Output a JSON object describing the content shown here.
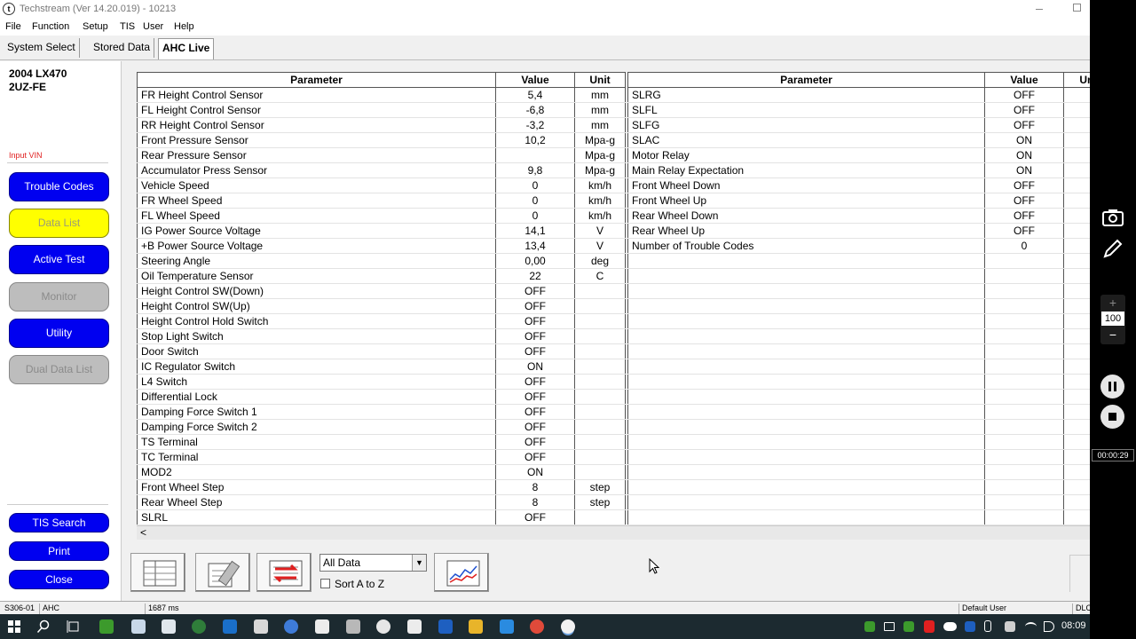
{
  "window": {
    "title": "Techstream (Ver 14.20.019) - 10213",
    "app_icon_glyph": "t"
  },
  "menu": [
    "File",
    "Function",
    "Setup",
    "TIS",
    "User",
    "Help"
  ],
  "tabs": [
    {
      "label": "System Select",
      "active": false
    },
    {
      "label": "Stored Data",
      "active": false
    },
    {
      "label": "AHC Live",
      "active": true
    }
  ],
  "vehicle": {
    "model": "2004 LX470",
    "engine": "2UZ-FE",
    "input_vin": "Input VIN"
  },
  "sidebar_buttons": [
    {
      "label": "Trouble Codes",
      "state": "blue"
    },
    {
      "label": "Data List",
      "state": "yellow"
    },
    {
      "label": "Active Test",
      "state": "blue"
    },
    {
      "label": "Monitor",
      "state": "gray"
    },
    {
      "label": "Utility",
      "state": "blue"
    },
    {
      "label": "Dual Data List",
      "state": "gray"
    }
  ],
  "sidebar_bottom_buttons": [
    {
      "label": "TIS Search"
    },
    {
      "label": "Print"
    },
    {
      "label": "Close"
    }
  ],
  "left_table": {
    "headers": [
      "Parameter",
      "Value",
      "Unit"
    ],
    "rows": [
      [
        "FR Height Control Sensor",
        "5,4",
        "mm"
      ],
      [
        "FL Height Control Sensor",
        "-6,8",
        "mm"
      ],
      [
        "RR Height Control Sensor",
        "-3,2",
        "mm"
      ],
      [
        "Front Pressure Sensor",
        "10,2",
        "Mpa-g"
      ],
      [
        "Rear Pressure Sensor",
        "",
        "Mpa-g"
      ],
      [
        "Accumulator Press Sensor",
        "9,8",
        "Mpa-g"
      ],
      [
        "Vehicle Speed",
        "0",
        "km/h"
      ],
      [
        "FR Wheel Speed",
        "0",
        "km/h"
      ],
      [
        "FL Wheel Speed",
        "0",
        "km/h"
      ],
      [
        "IG Power Source Voltage",
        "14,1",
        "V"
      ],
      [
        "+B Power Source Voltage",
        "13,4",
        "V"
      ],
      [
        "Steering Angle",
        "0,00",
        "deg"
      ],
      [
        "Oil Temperature Sensor",
        "22",
        "C"
      ],
      [
        "Height Control SW(Down)",
        "OFF",
        ""
      ],
      [
        "Height Control SW(Up)",
        "OFF",
        ""
      ],
      [
        "Height Control Hold Switch",
        "OFF",
        ""
      ],
      [
        "Stop Light Switch",
        "OFF",
        ""
      ],
      [
        "Door Switch",
        "OFF",
        ""
      ],
      [
        "IC Regulator Switch",
        "ON",
        ""
      ],
      [
        "L4 Switch",
        "OFF",
        ""
      ],
      [
        "Differential Lock",
        "OFF",
        ""
      ],
      [
        "Damping Force Switch 1",
        "OFF",
        ""
      ],
      [
        "Damping Force Switch 2",
        "OFF",
        ""
      ],
      [
        "TS Terminal",
        "OFF",
        ""
      ],
      [
        "TC Terminal",
        "OFF",
        ""
      ],
      [
        "MOD2",
        "ON",
        ""
      ],
      [
        "Front Wheel Step",
        "8",
        "step"
      ],
      [
        "Rear Wheel Step",
        "8",
        "step"
      ],
      [
        "SLRL",
        "OFF",
        ""
      ]
    ]
  },
  "right_table": {
    "headers": [
      "Parameter",
      "Value",
      "Ur"
    ],
    "rows": [
      [
        "SLRG",
        "OFF",
        ""
      ],
      [
        "SLFL",
        "OFF",
        ""
      ],
      [
        "SLFG",
        "OFF",
        ""
      ],
      [
        "SLAC",
        "ON",
        ""
      ],
      [
        "Motor Relay",
        "ON",
        ""
      ],
      [
        "Main Relay Expectation",
        "ON",
        ""
      ],
      [
        "Front Wheel Down",
        "OFF",
        ""
      ],
      [
        "Front Wheel Up",
        "OFF",
        ""
      ],
      [
        "Rear Wheel Down",
        "OFF",
        ""
      ],
      [
        "Rear Wheel Up",
        "OFF",
        ""
      ],
      [
        "Number of Trouble Codes",
        "0",
        ""
      ],
      [
        "",
        "",
        ""
      ],
      [
        "",
        "",
        ""
      ],
      [
        "",
        "",
        ""
      ],
      [
        "",
        "",
        ""
      ],
      [
        "",
        "",
        ""
      ],
      [
        "",
        "",
        ""
      ],
      [
        "",
        "",
        ""
      ],
      [
        "",
        "",
        ""
      ],
      [
        "",
        "",
        ""
      ],
      [
        "",
        "",
        ""
      ],
      [
        "",
        "",
        ""
      ],
      [
        "",
        "",
        ""
      ],
      [
        "",
        "",
        ""
      ],
      [
        "",
        "",
        ""
      ],
      [
        "",
        "",
        ""
      ],
      [
        "",
        "",
        ""
      ],
      [
        "",
        "",
        ""
      ],
      [
        "",
        "",
        ""
      ]
    ]
  },
  "scroll_left_arrow": "<",
  "toolbar": {
    "filter_value": "All Data",
    "dropdown_glyph": "▼",
    "sort_label": "Sort A to Z",
    "sort_checked": false
  },
  "status_bar": [
    "S306-01",
    "AHC",
    "1687 ms",
    "Default User",
    "DLC"
  ],
  "taskbar": {
    "time": "08:09"
  },
  "recorder": {
    "zoom": "100",
    "zoom_plus": "+",
    "zoom_minus": "−",
    "elapsed": "00:00:29"
  },
  "colors": {
    "button_blue": "#0000f0",
    "button_yellow": "#ffff00",
    "button_gray": "#bdbdbd",
    "vin_red": "#e02020"
  }
}
